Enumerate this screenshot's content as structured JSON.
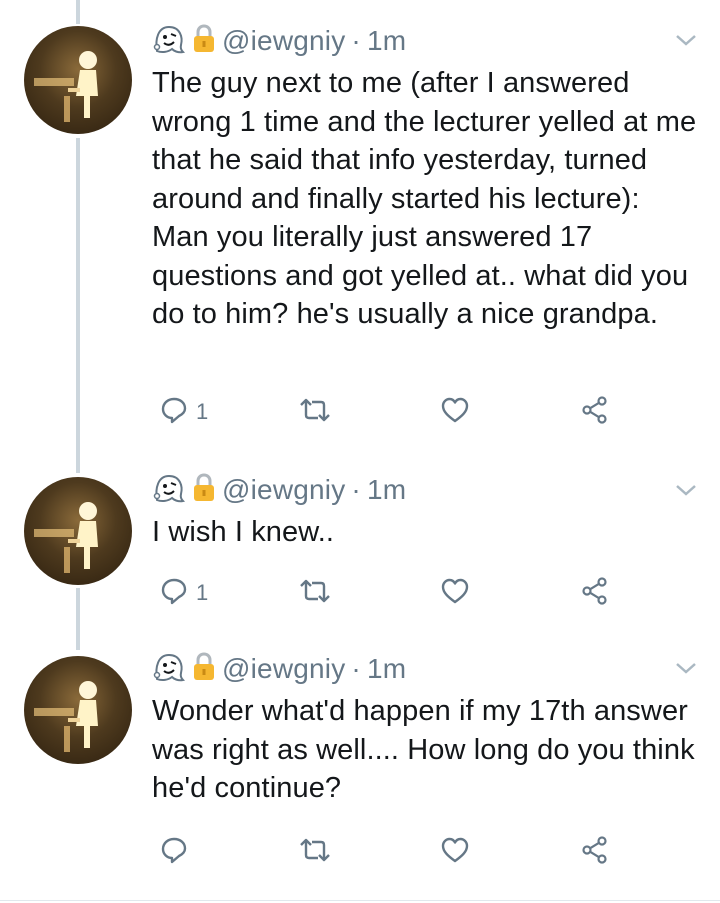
{
  "tweets": [
    {
      "handle": "@iewgniy",
      "separator": "·",
      "time": "1m",
      "text": "The guy next to me (after I answered wrong 1 time and the lecturer yelled at me that he said that info yesterday, turned around and finally started his lecture): Man you literally just answered 17 questions and got yelled at.. what did you do to him? he's usually a nice grandpa.",
      "reply_count": "1",
      "retweet_count": "",
      "like_count": ""
    },
    {
      "handle": "@iewgniy",
      "separator": "·",
      "time": "1m",
      "text": "I wish I knew..",
      "reply_count": "1",
      "retweet_count": "",
      "like_count": ""
    },
    {
      "handle": "@iewgniy",
      "separator": "·",
      "time": "1m",
      "text": "Wonder what'd happen if my 17th answer was right as well.... How long do you think he'd continue?",
      "reply_count": "",
      "retweet_count": "",
      "like_count": ""
    }
  ],
  "icons": {
    "ghost": "ghost-emoji-icon",
    "lock": "lock-icon",
    "chevron": "chevron-down-icon",
    "reply": "reply-icon",
    "retweet": "retweet-icon",
    "like": "heart-icon",
    "share": "share-icon"
  },
  "colors": {
    "text": "#14171a",
    "secondary": "#657786",
    "thread_line": "#ccd6dd",
    "lock_gold": "#f5b731"
  }
}
